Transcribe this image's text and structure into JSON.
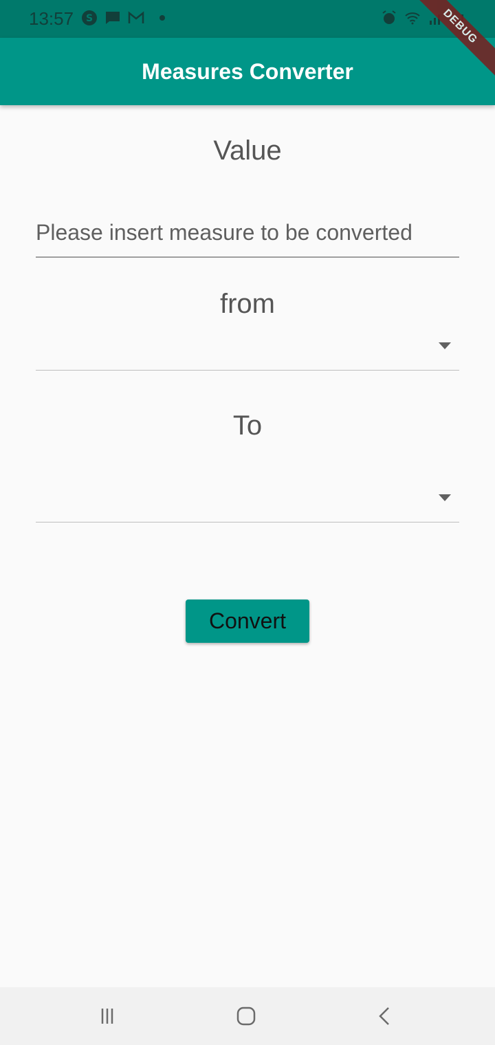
{
  "status_bar": {
    "time": "13:57",
    "left_icons": [
      "skype-icon",
      "message-icon",
      "gmail-icon",
      "notification-dot-icon"
    ],
    "right_icons": [
      "alarm-icon",
      "wifi-icon",
      "signal-icon",
      "signal-icon"
    ]
  },
  "app_bar": {
    "title": "Measures Converter",
    "debug_banner": "DEBUG",
    "color": "#009688"
  },
  "form": {
    "value_label": "Value",
    "value_input": {
      "value": "",
      "placeholder": "Please insert measure to be converted"
    },
    "from_label": "from",
    "from_dropdown": {
      "selected": ""
    },
    "to_label": "To",
    "to_dropdown": {
      "selected": ""
    },
    "convert_button": "Convert"
  },
  "nav_bar": {
    "buttons": [
      "recent-apps-icon",
      "home-icon",
      "back-icon"
    ]
  }
}
